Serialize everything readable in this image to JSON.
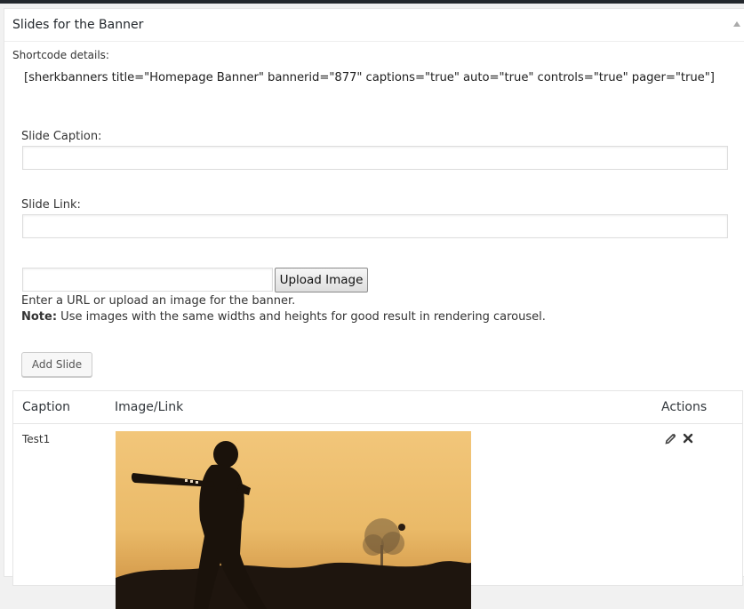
{
  "panel": {
    "title": "Slides for the Banner",
    "shortcode_label": "Shortcode details:",
    "shortcode": "[sherkbanners title=\"Homepage Banner\" bannerid=\"877\" captions=\"true\" auto=\"true\" controls=\"true\" pager=\"true\"]"
  },
  "form": {
    "caption_label": "Slide Caption:",
    "caption_value": "",
    "link_label": "Slide Link:",
    "link_value": "",
    "image_url_value": "",
    "upload_button": "Upload Image",
    "help_text": "Enter a URL or upload an image for the banner.",
    "note_label": "Note:",
    "note_text": " Use images with the same widths and heights for good result in rendering carousel.",
    "add_button": "Add Slide"
  },
  "table": {
    "headers": [
      "Caption",
      "Image/Link",
      "Actions"
    ],
    "rows": [
      {
        "caption": "Test1",
        "image": "cricket batsman silhouette at sunset"
      }
    ]
  },
  "icons": {
    "edit": "pencil-icon",
    "delete": "close-icon",
    "collapse": "triangle-up-icon"
  }
}
